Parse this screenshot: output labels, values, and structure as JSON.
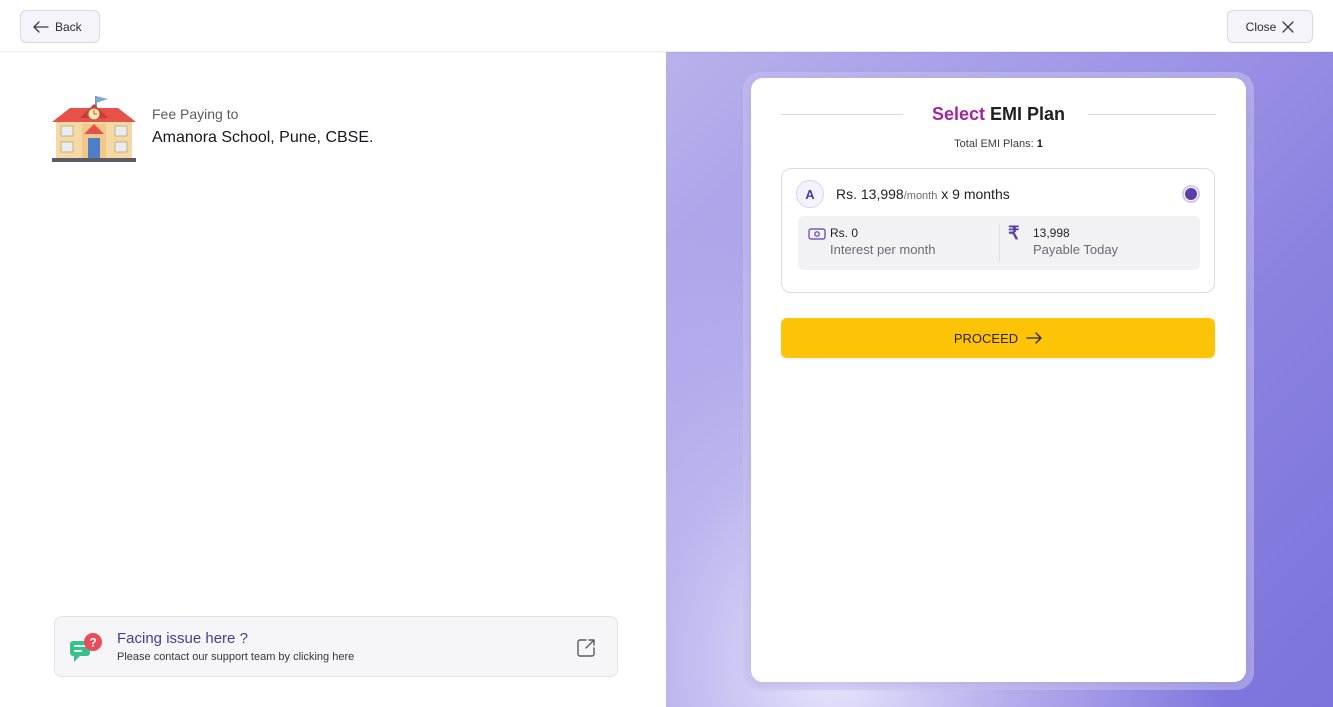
{
  "topbar": {
    "back_label": "Back",
    "close_label": "Close"
  },
  "school": {
    "fee_label": "Fee Paying to",
    "name": "Amanora School, Pune, CBSE."
  },
  "support": {
    "title": "Facing issue here ?",
    "subtitle": "Please contact our support team by clicking here"
  },
  "emi": {
    "title_highlight": "Select",
    "title_rest": " EMI Plan",
    "plans_count_label": "Total EMI Plans: ",
    "plans_count": "1",
    "plans": [
      {
        "letter": "A",
        "amount": "Rs. 13,998",
        "per": "/month",
        "duration": " x 9 months",
        "interest_value": "Rs. 0",
        "interest_label": "Interest per month",
        "currency_symbol": "₹",
        "payable_value": "13,998",
        "payable_label": "Payable Today",
        "selected": true
      }
    ],
    "proceed_label": "PROCEED"
  },
  "colors": {
    "accent_purple": "#5b3ea8",
    "title_magenta": "#a3249d",
    "proceed_yellow": "#fdc407",
    "background_violet": "#8a81e0"
  },
  "icons": [
    "arrow-left-icon",
    "close-icon",
    "school-building-icon",
    "support-chat-icon",
    "external-link-icon",
    "cash-icon",
    "rupee-icon",
    "arrow-right-icon"
  ]
}
